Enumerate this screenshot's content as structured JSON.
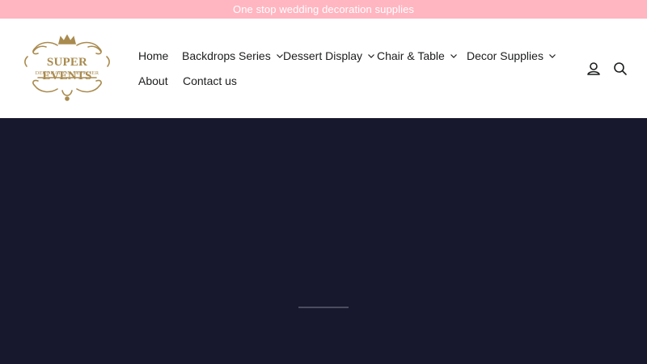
{
  "announcement": {
    "text": "One stop wedding decoration supplies"
  },
  "logo": {
    "title": "SUPER EVENTS",
    "subtitle": "DECORATION SUPPLIER",
    "color": "#a98b4f"
  },
  "nav": {
    "items": [
      {
        "label": "Home",
        "has_dropdown": false
      },
      {
        "label": "Backdrops Series",
        "has_dropdown": true
      },
      {
        "label": "Dessert Display",
        "has_dropdown": true
      },
      {
        "label": "Chair & Table",
        "has_dropdown": true
      },
      {
        "label": "Decor Supplies",
        "has_dropdown": true
      },
      {
        "label": "About",
        "has_dropdown": false
      },
      {
        "label": "Contact us",
        "has_dropdown": false
      }
    ]
  },
  "header_icons": {
    "account": "user-icon",
    "search": "search-icon"
  },
  "colors": {
    "announcement_bg": "#ffb6c1",
    "hero_bg": "#17182d",
    "text": "#1c1d1d"
  }
}
